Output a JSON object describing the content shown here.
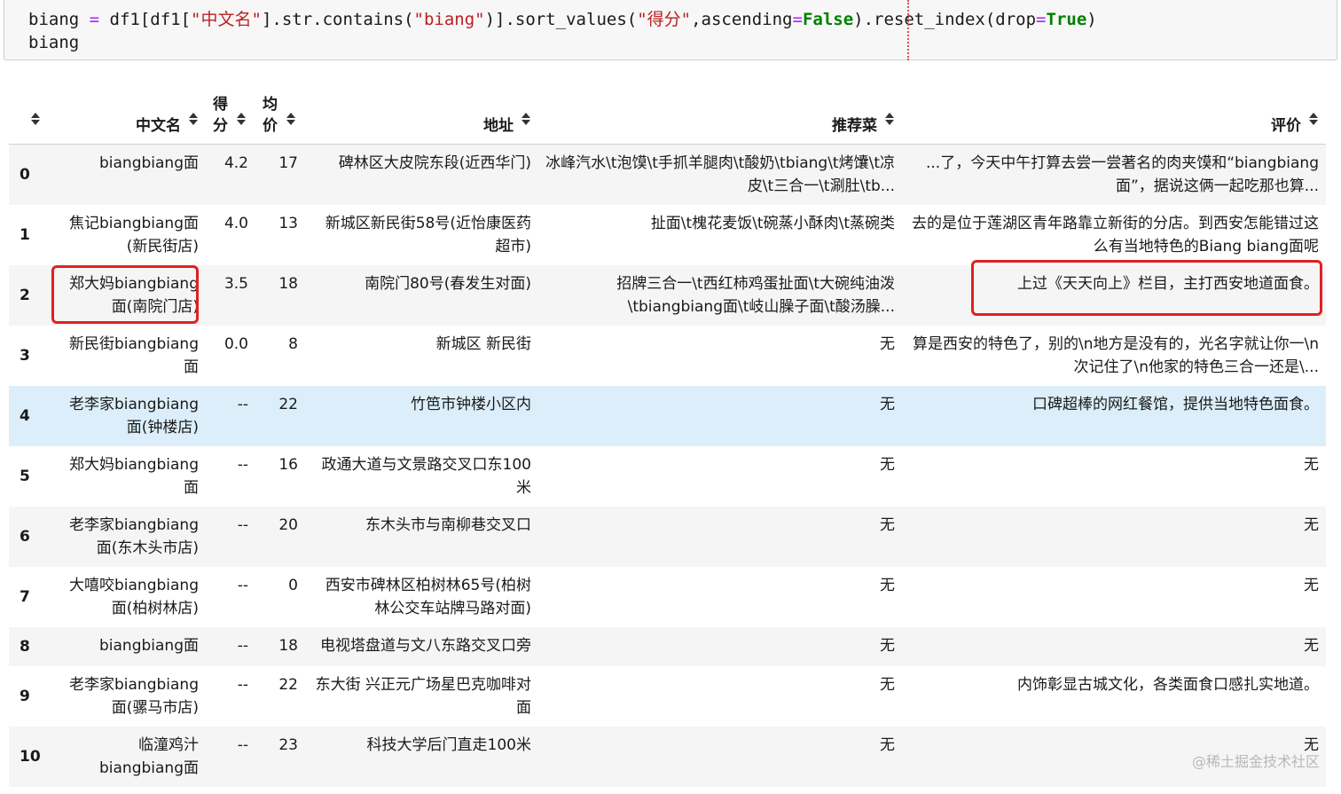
{
  "code": {
    "line1_var": "biang ",
    "line1_eq": "=",
    "line1_a": " df1[df1[",
    "line1_s1": "\"中文名\"",
    "line1_b": "].str.contains(",
    "line1_s2": "\"biang\"",
    "line1_c": ")].sort_values(",
    "line1_s3": "\"得分\"",
    "line1_d": ",ascending",
    "line1_eq2": "=",
    "line1_k1": "False",
    "line1_e": ").reset_index(drop",
    "line1_eq3": "=",
    "line1_k2": "True",
    "line1_f": ")",
    "line2": "biang"
  },
  "table": {
    "columns": [
      "中文名",
      "得分",
      "均价",
      "地址",
      "推荐菜",
      "评价"
    ],
    "rows": [
      {
        "index": "0",
        "name": "biangbiang面",
        "score": "4.2",
        "price": "17",
        "address": "碑林区大皮院东段(近西华门)",
        "dishes": "冰峰汽水\\t泡馍\\t手抓羊腿肉\\t酸奶\\tbiang\\t烤馕\\t凉皮\\t三合一\\t涮肚\\tb...",
        "review": "...了，今天中午打算去尝一尝著名的肉夹馍和“biangbiang面”，据说这俩一起吃那也算..."
      },
      {
        "index": "1",
        "name": "焦记biangbiang面(新民街店)",
        "score": "4.0",
        "price": "13",
        "address": "新城区新民街58号(近怡康医药超市)",
        "dishes": "扯面\\t槐花麦饭\\t碗蒸小酥肉\\t蒸碗类",
        "review": "去的是位于莲湖区青年路靠立新街的分店。到西安怎能错过这么有当地特色的Biang biang面呢"
      },
      {
        "index": "2",
        "name": "郑大妈biangbiang面(南院门店)",
        "score": "3.5",
        "price": "18",
        "address": "南院门80号(春发生对面)",
        "dishes": "招牌三合一\\t西红柿鸡蛋扯面\\t大碗纯油泼\\tbiangbiang面\\t岐山臊子面\\t酸汤臊...",
        "review": "上过《天天向上》栏目，主打西安地道面食。"
      },
      {
        "index": "3",
        "name": "新民街biangbiang面",
        "score": "0.0",
        "price": "8",
        "address": "新城区 新民街",
        "dishes": "无",
        "review": "算是西安的特色了，别的\\n地方是没有的，光名字就让你一\\n次记住了\\n他家的特色三合一还是\\..."
      },
      {
        "index": "4",
        "name": "老李家biangbiang面(钟楼店)",
        "score": "--",
        "price": "22",
        "address": "竹笆市钟楼小区内",
        "dishes": "无",
        "review": "口碑超棒的网红餐馆，提供当地特色面食。"
      },
      {
        "index": "5",
        "name": "郑大妈biangbiang面",
        "score": "--",
        "price": "16",
        "address": "政通大道与文景路交叉口东100米",
        "dishes": "无",
        "review": "无"
      },
      {
        "index": "6",
        "name": "老李家biangbiang面(东木头市店)",
        "score": "--",
        "price": "20",
        "address": "东木头市与南柳巷交叉口",
        "dishes": "无",
        "review": "无"
      },
      {
        "index": "7",
        "name": "大嘻咬biangbiang面(柏树林店)",
        "score": "--",
        "price": "0",
        "address": "西安市碑林区柏树林65号(柏树林公交车站牌马路对面)",
        "dishes": "无",
        "review": "无"
      },
      {
        "index": "8",
        "name": "biangbiang面",
        "score": "--",
        "price": "18",
        "address": "电视塔盘道与文八东路交叉口旁",
        "dishes": "无",
        "review": "无"
      },
      {
        "index": "9",
        "name": "老李家biangbiang面(骡马市店)",
        "score": "--",
        "price": "22",
        "address": "东大街 兴正元广场星巴克咖啡对面",
        "dishes": "无",
        "review": "内饰彰显古城文化，各类面食口感扎实地道。"
      },
      {
        "index": "10",
        "name": "临潼鸡汁biangbiang面",
        "score": "--",
        "price": "23",
        "address": "科技大学后门直走100米",
        "dishes": "无",
        "review": "无"
      }
    ]
  },
  "watermark": "@稀土掘金技术社区"
}
